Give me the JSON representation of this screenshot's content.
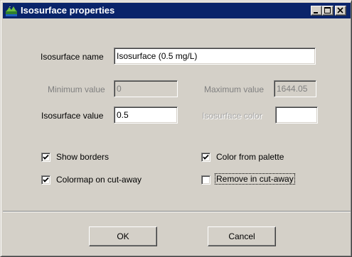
{
  "window": {
    "title": "Isosurface properties",
    "icon": "app-icon"
  },
  "titlebar_buttons": {
    "minimize": "minimize-icon",
    "maximize": "maximize-icon",
    "close": "close-icon"
  },
  "form": {
    "name_label": "Isosurface name",
    "name_value": "Isosurface (0.5 mg/L)",
    "min_label": "Minimum value",
    "min_value": "0",
    "max_label": "Maximum value",
    "max_value": "1644.05",
    "iso_value_label": "Isosurface value",
    "iso_value": "0.5",
    "iso_color_label": "Isosurface color",
    "iso_color_value": ""
  },
  "options": {
    "show_borders": {
      "label": "Show borders",
      "checked": true
    },
    "color_from_palette": {
      "label": "Color from palette",
      "checked": true
    },
    "colormap_cutaway": {
      "label": "Colormap on cut-away",
      "checked": true
    },
    "remove_cutaway": {
      "label": "Remove in cut-away",
      "checked": false
    }
  },
  "buttons": {
    "ok": "OK",
    "cancel": "Cancel"
  },
  "colors": {
    "titlebar": "#0a246a",
    "face": "#d4d0c8"
  }
}
